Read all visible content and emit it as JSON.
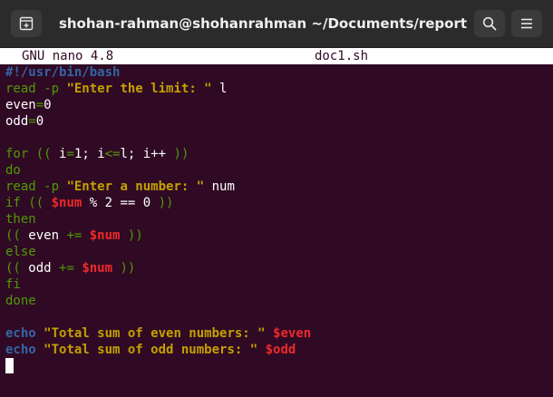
{
  "window": {
    "title": "shohan-rahman@shohanrahman ~/Documents/report",
    "buttons": {
      "new_tab_icon": "new-tab-icon",
      "search_icon": "search-icon",
      "menu_icon": "hamburger-menu-icon"
    }
  },
  "nano": {
    "version": "GNU nano 4.8",
    "filename": "doc1.sh"
  },
  "colors": {
    "terminal_bg": "#300a24",
    "titlebar_bg": "#2b2b2b",
    "syntax_green": "#4e9a06",
    "syntax_yellow": "#c4a000",
    "syntax_red": "#ef2929",
    "syntax_blue": "#3465a4"
  },
  "code": {
    "l1": "#!/usr/bin/bash",
    "l2": {
      "kw": "read",
      "flag": "-p",
      "str": "\"Enter the limit: \"",
      "var": "l"
    },
    "l3": {
      "name": "even",
      "op": "=",
      "val": "0"
    },
    "l4": {
      "name": "odd",
      "op": "=",
      "val": "0"
    },
    "l6": {
      "kw": "for",
      "open": "((",
      "i1": "i",
      "eq": "=",
      "n1": "1;",
      "i2": "i",
      "le": "<=",
      "l": "l;",
      "i3": "i++",
      "close": "))"
    },
    "l7": "do",
    "l8": {
      "kw": "read",
      "flag": "-p",
      "str": "\"Enter a number: \"",
      "var": "num"
    },
    "l9": {
      "kw": "if",
      "open": "((",
      "var": "$num",
      "rest": "% 2 == 0",
      "close": "))"
    },
    "l10": "then",
    "l11": {
      "open": "((",
      "name": "even",
      "op": "+=",
      "var": "$num",
      "close": "))"
    },
    "l12": "else",
    "l13": {
      "open": "((",
      "name": "odd",
      "op": "+=",
      "var": "$num",
      "close": "))"
    },
    "l14": "fi",
    "l15": "done",
    "l17": {
      "kw": "echo",
      "str": "\"Total sum of even numbers: \"",
      "var": "$even"
    },
    "l18": {
      "kw": "echo",
      "str": "\"Total sum of odd numbers: \"",
      "var": "$odd"
    }
  }
}
